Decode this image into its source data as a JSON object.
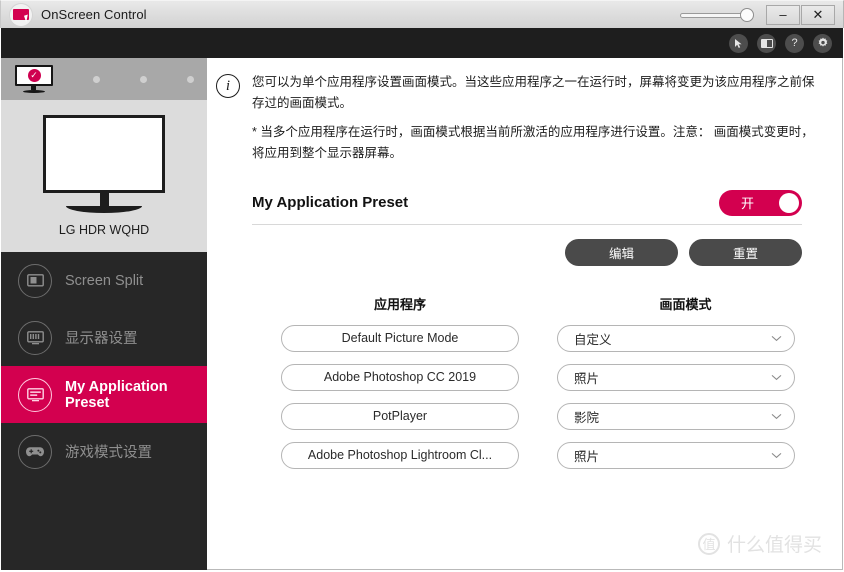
{
  "window": {
    "title": "OnScreen Control",
    "app_icon": "monitor-cursor-icon",
    "minimize_label": "–",
    "close_label": "✕",
    "opacity_slider": "opacity-slider"
  },
  "toolbar": {
    "icons": [
      {
        "name": "cursor-icon",
        "glyph": "↖"
      },
      {
        "name": "monitor-icon",
        "glyph": "■"
      },
      {
        "name": "help-icon",
        "glyph": "?"
      },
      {
        "name": "gear-icon",
        "glyph": "⚙"
      }
    ]
  },
  "sidebar": {
    "monitor_strip": {
      "active_icon": "monitor-check-icon",
      "check_glyph": "✓",
      "dots": 3
    },
    "monitor_preview": {
      "label": "LG HDR WQHD",
      "icon": "monitor-preview-icon"
    },
    "items": [
      {
        "label": "Screen Split",
        "icon": "screen-split-icon",
        "active": false
      },
      {
        "label": "显示器设置",
        "icon": "monitor-settings-icon",
        "active": false
      },
      {
        "label": "My Application Preset",
        "icon": "application-preset-icon",
        "active": true
      },
      {
        "label": "游戏模式设置",
        "icon": "gamepad-icon",
        "active": false
      }
    ]
  },
  "main": {
    "info": {
      "icon": "info-icon",
      "icon_glyph": "i",
      "paragraph": "您可以为单个应用程序设置画面模式。当这些应用程序之一在运行时，屏幕将变更为该应用程序之前保存过的画面模式。",
      "note": "* 当多个应用程序在运行时，画面模式根据当前所激活的应用程序进行设置。注意： 画面模式变更时，将应用到整个显示器屏幕。"
    },
    "preset": {
      "title": "My Application Preset",
      "toggle_label": "开",
      "toggle_on": true
    },
    "actions": {
      "edit_label": "编辑",
      "reset_label": "重置"
    },
    "table": {
      "headers": {
        "application": "应用程序",
        "picture_mode": "画面模式"
      },
      "rows": [
        {
          "application": "Default Picture Mode",
          "picture_mode": "自定义"
        },
        {
          "application": "Adobe Photoshop CC 2019",
          "picture_mode": "照片"
        },
        {
          "application": "PotPlayer",
          "picture_mode": "影院"
        },
        {
          "application": "Adobe Photoshop Lightroom Cl...",
          "picture_mode": "照片"
        }
      ],
      "chevron": "⌄"
    }
  },
  "watermark": {
    "badge": "值",
    "text": "什么值得买"
  },
  "colors": {
    "accent_pink": "#d3004f",
    "sidebar_dark": "#272727",
    "topbar_dark": "#1e1e1e",
    "button_gray": "#4a4a4a"
  }
}
